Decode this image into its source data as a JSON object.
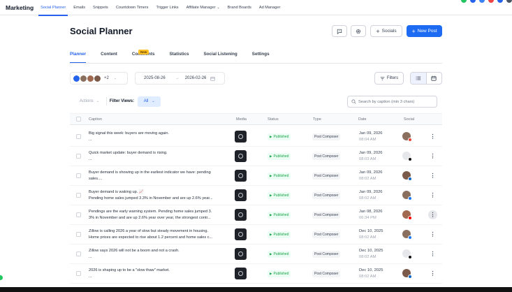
{
  "app": {
    "brand": "Marketing",
    "nav": [
      {
        "label": "Social Planner",
        "active": true
      },
      {
        "label": "Emails"
      },
      {
        "label": "Snippets"
      },
      {
        "label": "Countdown Timers"
      },
      {
        "label": "Trigger Links"
      },
      {
        "label": "Affiliate Manager",
        "dropdown": true
      },
      {
        "label": "Brand Boards"
      },
      {
        "label": "Ad Manager"
      }
    ]
  },
  "header": {
    "title": "Social Planner",
    "socials_label": "Socials",
    "new_post_label": "New Post",
    "feedback_icon": "chat-bubble-icon",
    "settings_icon": "gear-icon"
  },
  "tabs": [
    {
      "label": "Planner",
      "active": true
    },
    {
      "label": "Content"
    },
    {
      "label": "Comments",
      "badge": "New"
    },
    {
      "label": "Statistics"
    },
    {
      "label": "Social Listening"
    },
    {
      "label": "Settings"
    }
  ],
  "filters": {
    "accounts_more": "+2",
    "date_from": "2025-08-26",
    "date_to": "2026-02-26",
    "filters_label": "Filters",
    "actions_label": "Actions",
    "filter_views_label": "Filter Views:",
    "filter_views_value": "All",
    "search_placeholder": "Search by caption (min 3 chars)"
  },
  "table": {
    "columns": [
      "Caption",
      "Media",
      "Status",
      "Type",
      "Date",
      "Social"
    ],
    "rows": [
      {
        "line1": "Big signal this week: buyers are moving again.",
        "line2": "...",
        "status": "Published",
        "type": "Post Composer",
        "date": "Jan 09, 2026",
        "time": "08:04 AM",
        "social": "google",
        "kebab_hl": false
      },
      {
        "line1": "Quick market update: buyer demand is rising.",
        "line2": "...",
        "status": "Published",
        "type": "Post Composer",
        "date": "Jan 09, 2026",
        "time": "08:03 AM",
        "social": "tiktok",
        "kebab_hl": false
      },
      {
        "line1": "Buyer demand is showing up in the earliest indicator we have: pending",
        "line2": "sales....",
        "status": "Published",
        "type": "Post Composer",
        "date": "Jan 09, 2026",
        "time": "08:02 AM",
        "social": "linkedin",
        "kebab_hl": false
      },
      {
        "line1": "Buyer demand is waking up. 📈",
        "line2": "Pending home sales jumped 3.3% in November and are up 2.6% year...",
        "status": "Published",
        "type": "Post Composer",
        "date": "Jan 09, 2026",
        "time": "08:02 AM",
        "social": "facebook",
        "kebab_hl": false
      },
      {
        "line1": "Pendings are the early warning system. Pending home sales jumped 3.",
        "line2": "3% in November and are up 2.6% year over year, the strongest contr...",
        "status": "Published",
        "type": "Post Composer",
        "date": "Jan 08, 2026",
        "time": "06:34 PM",
        "social": "youtube",
        "kebab_hl": true
      },
      {
        "line1": "Zillow is calling 2026 a year of slow but steady movement in housing.",
        "line2": "Home prices are expected to rise about 1.2 percent and home sales c...",
        "status": "Published",
        "type": "Post Composer",
        "date": "Dec 10, 2025",
        "time": "08:02 AM",
        "social": "facebook",
        "kebab_hl": false
      },
      {
        "line1": "Zillow says 2026 will not be a boom and not a crash.",
        "line2": "...",
        "status": "Published",
        "type": "Post Composer",
        "date": "Dec 10, 2025",
        "time": "08:02 AM",
        "social": "tiktok",
        "kebab_hl": false
      },
      {
        "line1": "2026 is shaping up to be a \"slow thaw\" market.",
        "line2": "...",
        "status": "Published",
        "type": "Post Composer",
        "date": "Dec 10, 2025",
        "time": "08:02 AM",
        "social": "linkedin",
        "kebab_hl": false
      }
    ]
  },
  "colors": {
    "accent": "#2563eb",
    "primary_button": "#1d6bf3",
    "published": "#16a34a",
    "new_badge": "#fbbf24"
  }
}
